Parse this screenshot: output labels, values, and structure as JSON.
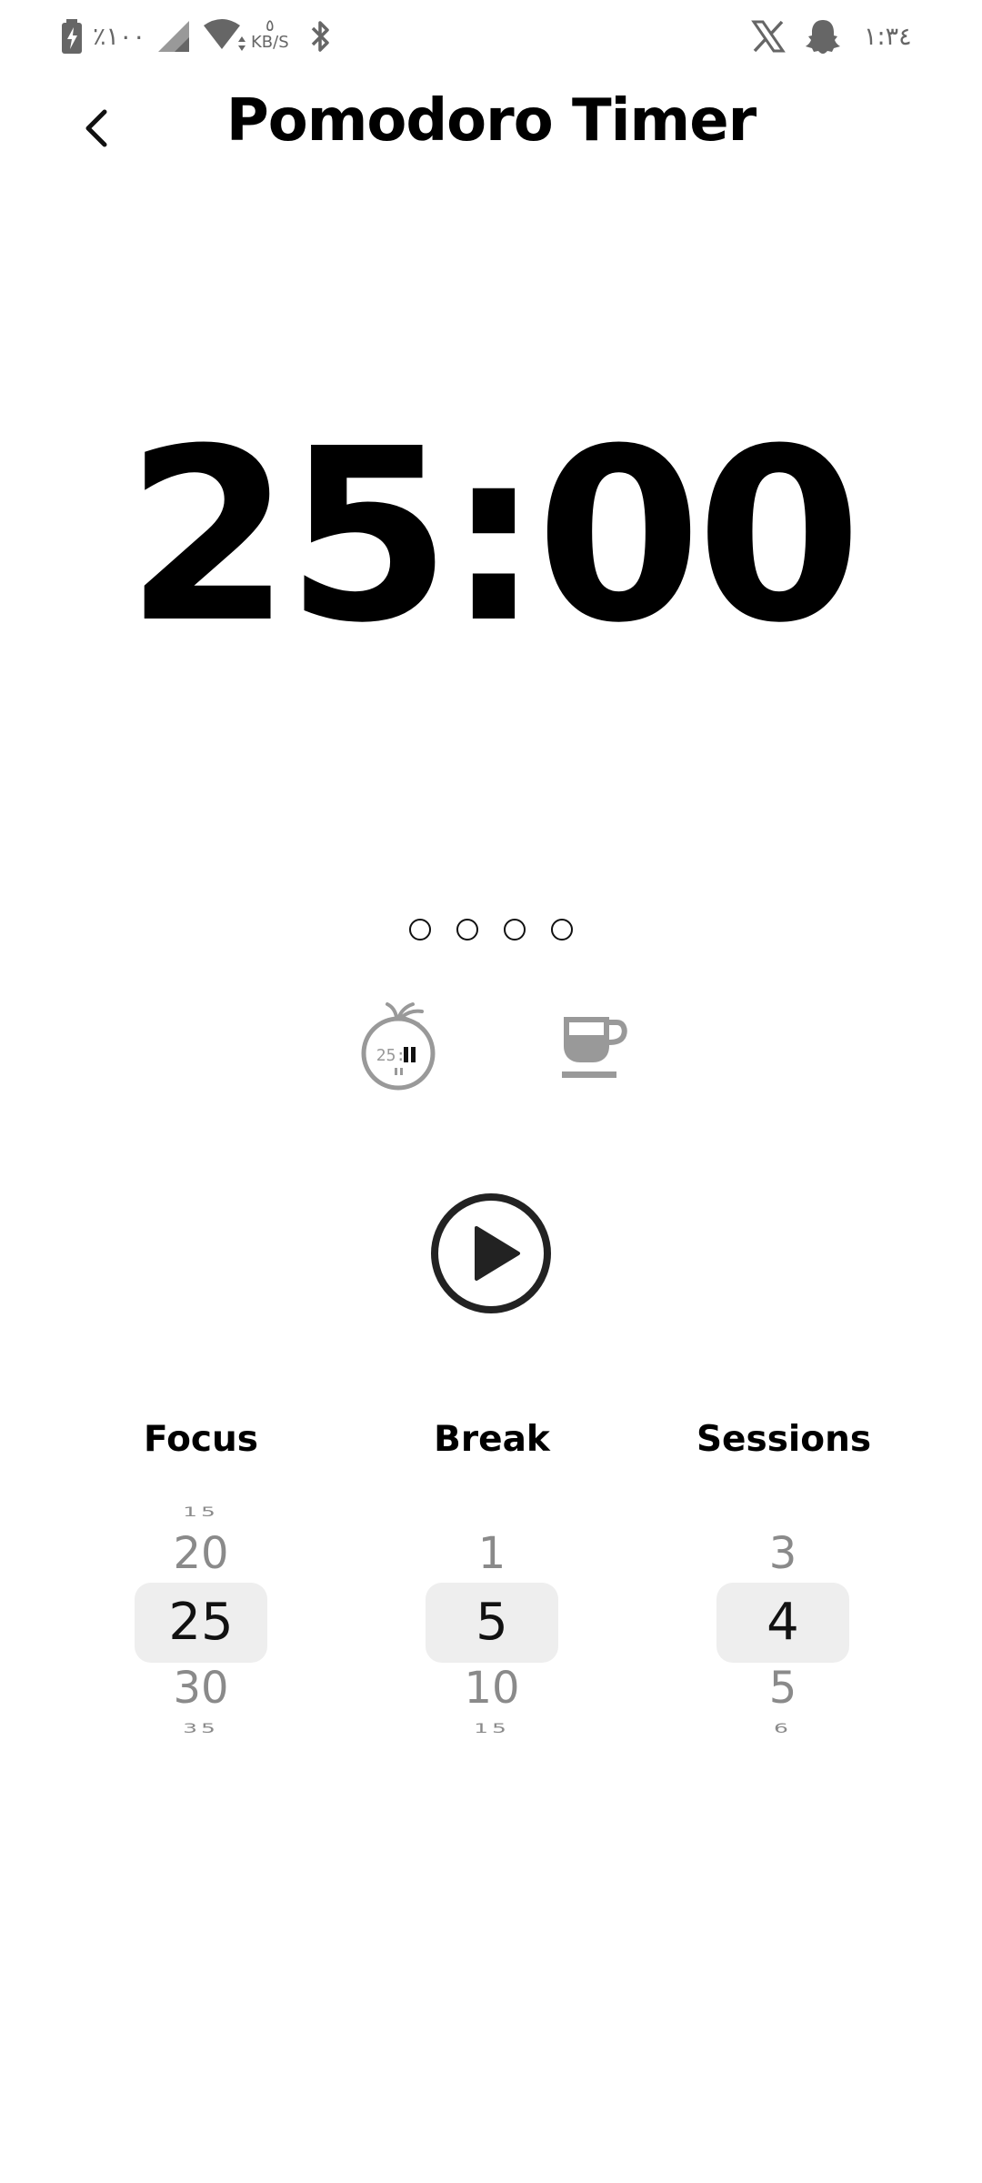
{
  "status_bar": {
    "battery": "٪١٠٠",
    "speed_value": "٥",
    "speed_unit": "KB/S",
    "time": "١:٣٤",
    "icons": [
      "battery-charging-icon",
      "signal-icon",
      "wifi-icon",
      "bluetooth-icon",
      "x-icon",
      "snapchat-icon"
    ]
  },
  "header": {
    "title": "Pomodoro Timer",
    "back_icon": "chevron-left-icon"
  },
  "timer": {
    "display": "25:00"
  },
  "sessions": {
    "total": 4,
    "completed": 0
  },
  "modes": [
    {
      "name": "focus",
      "icon": "tomato-timer-icon",
      "icon_text": "25:"
    },
    {
      "name": "break",
      "icon": "coffee-cup-icon"
    }
  ],
  "controls": {
    "play_icon": "play-circle-icon"
  },
  "pickers": {
    "focus": {
      "label": "Focus",
      "values": [
        "15",
        "20",
        "25",
        "30",
        "35"
      ],
      "selected": "25"
    },
    "break": {
      "label": "Break",
      "values": [
        "1",
        "5",
        "10",
        "15"
      ],
      "selected": "5"
    },
    "sessions": {
      "label": "Sessions",
      "values": [
        "3",
        "4",
        "5",
        "6"
      ],
      "selected": "4"
    }
  },
  "colors": {
    "text": "#000000",
    "muted": "#8a8a8a",
    "highlight": "#eeeeee",
    "icon_gray": "#999999"
  }
}
